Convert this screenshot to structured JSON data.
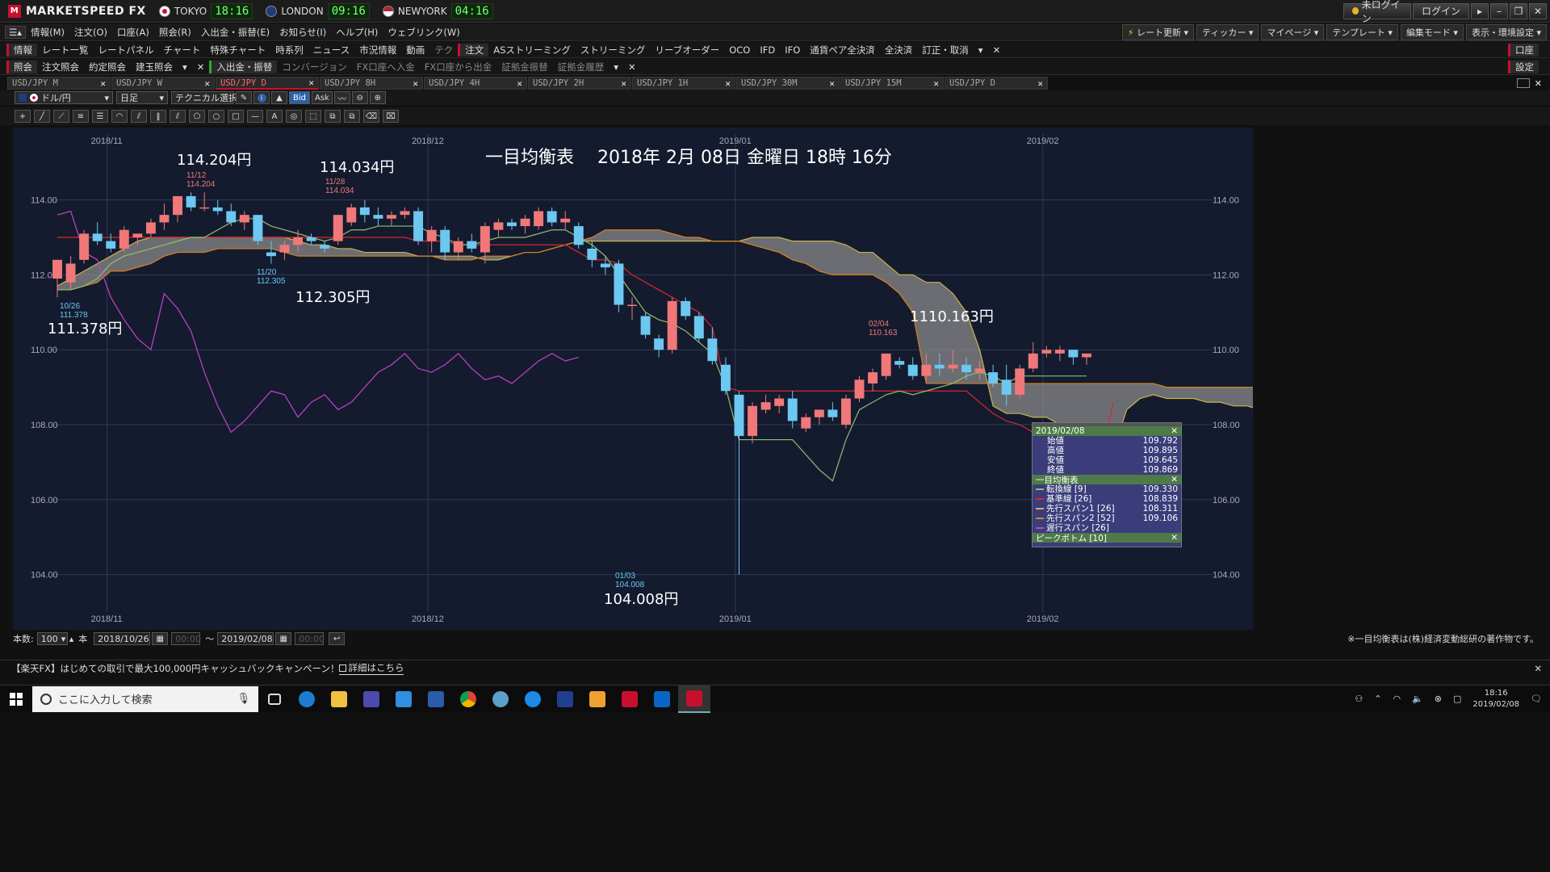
{
  "app": {
    "title": "MARKETSPEED FX",
    "logo_mark": "M",
    "clocks": [
      {
        "city": "TOKYO",
        "time": "18:16"
      },
      {
        "city": "LONDON",
        "time": "09:16"
      },
      {
        "city": "NEWYORK",
        "time": "04:16"
      }
    ],
    "login_status": "未ログイン",
    "login_button": "ログイン"
  },
  "menu": {
    "items": [
      "情報(M)",
      "注文(O)",
      "口座(A)",
      "照会(R)",
      "入出金・振替(E)",
      "お知らせ(I)",
      "ヘルプ(H)",
      "ウェブリンク(W)"
    ],
    "right": [
      "レート更新",
      "ティッカー",
      "マイページ",
      "テンプレート",
      "編集モード",
      "表示・環境設定"
    ]
  },
  "toolbar1": {
    "items": [
      "情報",
      "レート一覧",
      "レートパネル",
      "チャート",
      "特殊チャート",
      "時系列",
      "ニュース",
      "市況情報",
      "動画",
      "テク",
      "注文",
      "ASストリーミング",
      "ストリーミング",
      "リーブオーダー",
      "OCO",
      "IFD",
      "IFO",
      "通貨ペア全決済",
      "全決済",
      "訂正・取消"
    ],
    "right": "口座"
  },
  "toolbar2": {
    "items": [
      "照会",
      "注文照会",
      "約定照会",
      "建玉照会",
      "入出金・振替",
      "コンバージョン",
      "FX口座へ入金",
      "FX口座から出金",
      "証拠金振替",
      "証拠金履歴"
    ],
    "right": "設定"
  },
  "tabs": [
    "USD/JPY M",
    "USD/JPY W",
    "USD/JPY D",
    "USD/JPY 8H",
    "USD/JPY 4H",
    "USD/JPY 2H",
    "USD/JPY 1H",
    "USD/JPY 30M",
    "USD/JPY 15M",
    "USD/JPY D"
  ],
  "active_tab": 2,
  "chart_toolbar": {
    "pair": "ドル/円",
    "period": "日足",
    "technical": "テクニカル選択",
    "bid": "Bid",
    "ask": "Ask"
  },
  "chart_data": {
    "type": "candlestick",
    "title": "一目均衡表　 2018年 2月 08日 金曜日 18時 16分",
    "x_labels": [
      "2018/11",
      "2018/12",
      "2019/01",
      "2019/02"
    ],
    "y_ticks": [
      "114.00",
      "112.00",
      "110.00",
      "108.00",
      "106.00",
      "104.00"
    ],
    "ylim": [
      103.0,
      115.5
    ],
    "annotations": [
      {
        "text": "114.204円",
        "date": "11/12",
        "value": "114.204"
      },
      {
        "text": "114.034円",
        "date": "11/28",
        "value": "114.034"
      },
      {
        "text": "112.305円",
        "date": "11/20",
        "value": "112.305"
      },
      {
        "text": "111.378円",
        "date": "10/26",
        "value": "111.378"
      },
      {
        "text": "104.008円",
        "date": "01/03",
        "value": "104.008"
      },
      {
        "text": "1110.163円",
        "date": "02/04",
        "value": "110.163"
      }
    ],
    "candles": [
      {
        "o": 111.9,
        "h": 112.4,
        "l": 111.4,
        "c": 112.4
      },
      {
        "o": 111.8,
        "h": 112.5,
        "l": 111.6,
        "c": 112.3
      },
      {
        "o": 112.4,
        "h": 113.2,
        "l": 112.3,
        "c": 113.1
      },
      {
        "o": 113.1,
        "h": 113.4,
        "l": 112.8,
        "c": 112.9
      },
      {
        "o": 112.9,
        "h": 113.1,
        "l": 112.6,
        "c": 112.7
      },
      {
        "o": 112.7,
        "h": 113.3,
        "l": 112.6,
        "c": 113.2
      },
      {
        "o": 113.0,
        "h": 113.1,
        "l": 112.8,
        "c": 113.1
      },
      {
        "o": 113.1,
        "h": 113.5,
        "l": 113.0,
        "c": 113.4
      },
      {
        "o": 113.4,
        "h": 113.9,
        "l": 113.2,
        "c": 113.6
      },
      {
        "o": 113.6,
        "h": 114.1,
        "l": 113.4,
        "c": 114.1
      },
      {
        "o": 114.1,
        "h": 114.2,
        "l": 113.7,
        "c": 113.8
      },
      {
        "o": 113.8,
        "h": 114.2,
        "l": 113.7,
        "c": 113.8
      },
      {
        "o": 113.8,
        "h": 114.0,
        "l": 113.6,
        "c": 113.7
      },
      {
        "o": 113.7,
        "h": 113.9,
        "l": 113.3,
        "c": 113.4
      },
      {
        "o": 113.4,
        "h": 113.7,
        "l": 113.2,
        "c": 113.6
      },
      {
        "o": 113.6,
        "h": 113.6,
        "l": 112.8,
        "c": 112.9
      },
      {
        "o": 112.6,
        "h": 112.9,
        "l": 112.3,
        "c": 112.5
      },
      {
        "o": 112.6,
        "h": 112.9,
        "l": 112.4,
        "c": 112.8
      },
      {
        "o": 112.8,
        "h": 113.2,
        "l": 112.6,
        "c": 113.0
      },
      {
        "o": 113.0,
        "h": 113.1,
        "l": 112.8,
        "c": 112.9
      },
      {
        "o": 112.8,
        "h": 112.9,
        "l": 112.6,
        "c": 112.7
      },
      {
        "o": 112.9,
        "h": 113.6,
        "l": 112.8,
        "c": 113.6
      },
      {
        "o": 113.4,
        "h": 113.9,
        "l": 113.3,
        "c": 113.8
      },
      {
        "o": 113.8,
        "h": 114.0,
        "l": 113.4,
        "c": 113.6
      },
      {
        "o": 113.6,
        "h": 113.8,
        "l": 113.3,
        "c": 113.5
      },
      {
        "o": 113.5,
        "h": 113.7,
        "l": 113.3,
        "c": 113.6
      },
      {
        "o": 113.6,
        "h": 113.8,
        "l": 113.5,
        "c": 113.7
      },
      {
        "o": 113.7,
        "h": 113.8,
        "l": 112.8,
        "c": 112.9
      },
      {
        "o": 112.9,
        "h": 113.3,
        "l": 112.6,
        "c": 113.2
      },
      {
        "o": 113.2,
        "h": 113.3,
        "l": 112.4,
        "c": 112.6
      },
      {
        "o": 112.6,
        "h": 113.0,
        "l": 112.4,
        "c": 112.9
      },
      {
        "o": 112.9,
        "h": 113.1,
        "l": 112.6,
        "c": 112.7
      },
      {
        "o": 112.6,
        "h": 113.4,
        "l": 112.3,
        "c": 113.3
      },
      {
        "o": 113.2,
        "h": 113.5,
        "l": 113.0,
        "c": 113.4
      },
      {
        "o": 113.4,
        "h": 113.5,
        "l": 113.2,
        "c": 113.3
      },
      {
        "o": 113.3,
        "h": 113.6,
        "l": 113.1,
        "c": 113.5
      },
      {
        "o": 113.3,
        "h": 113.8,
        "l": 113.2,
        "c": 113.7
      },
      {
        "o": 113.7,
        "h": 113.8,
        "l": 113.3,
        "c": 113.4
      },
      {
        "o": 113.4,
        "h": 113.7,
        "l": 113.2,
        "c": 113.5
      },
      {
        "o": 113.3,
        "h": 113.4,
        "l": 112.7,
        "c": 112.8
      },
      {
        "o": 112.7,
        "h": 112.9,
        "l": 112.2,
        "c": 112.4
      },
      {
        "o": 112.3,
        "h": 112.5,
        "l": 112.0,
        "c": 112.2
      },
      {
        "o": 112.3,
        "h": 112.4,
        "l": 111.0,
        "c": 111.2
      },
      {
        "o": 111.2,
        "h": 111.4,
        "l": 110.8,
        "c": 111.2
      },
      {
        "o": 110.9,
        "h": 111.0,
        "l": 110.3,
        "c": 110.4
      },
      {
        "o": 110.3,
        "h": 110.4,
        "l": 109.8,
        "c": 110.0
      },
      {
        "o": 110.0,
        "h": 111.4,
        "l": 109.9,
        "c": 111.3
      },
      {
        "o": 111.3,
        "h": 111.4,
        "l": 110.8,
        "c": 110.9
      },
      {
        "o": 110.9,
        "h": 111.0,
        "l": 110.2,
        "c": 110.3
      },
      {
        "o": 110.3,
        "h": 110.6,
        "l": 109.6,
        "c": 109.7
      },
      {
        "o": 109.6,
        "h": 109.8,
        "l": 108.8,
        "c": 108.9
      },
      {
        "o": 108.8,
        "h": 108.9,
        "l": 104.0,
        "c": 107.7
      },
      {
        "o": 107.7,
        "h": 108.6,
        "l": 107.5,
        "c": 108.5
      },
      {
        "o": 108.4,
        "h": 108.8,
        "l": 108.3,
        "c": 108.6
      },
      {
        "o": 108.5,
        "h": 108.8,
        "l": 108.3,
        "c": 108.7
      },
      {
        "o": 108.7,
        "h": 108.9,
        "l": 107.9,
        "c": 108.1
      },
      {
        "o": 107.9,
        "h": 108.3,
        "l": 107.8,
        "c": 108.2
      },
      {
        "o": 108.2,
        "h": 108.4,
        "l": 108.0,
        "c": 108.4
      },
      {
        "o": 108.4,
        "h": 108.6,
        "l": 108.1,
        "c": 108.2
      },
      {
        "o": 108.0,
        "h": 108.8,
        "l": 107.9,
        "c": 108.7
      },
      {
        "o": 108.7,
        "h": 109.3,
        "l": 108.6,
        "c": 109.2
      },
      {
        "o": 109.1,
        "h": 109.5,
        "l": 108.9,
        "c": 109.4
      },
      {
        "o": 109.3,
        "h": 109.9,
        "l": 109.2,
        "c": 109.9
      },
      {
        "o": 109.7,
        "h": 109.8,
        "l": 109.5,
        "c": 109.6
      },
      {
        "o": 109.6,
        "h": 109.8,
        "l": 109.2,
        "c": 109.3
      },
      {
        "o": 109.3,
        "h": 109.9,
        "l": 109.2,
        "c": 109.6
      },
      {
        "o": 109.6,
        "h": 109.9,
        "l": 109.3,
        "c": 109.5
      },
      {
        "o": 109.5,
        "h": 110.0,
        "l": 109.4,
        "c": 109.6
      },
      {
        "o": 109.6,
        "h": 109.8,
        "l": 109.2,
        "c": 109.4
      },
      {
        "o": 109.4,
        "h": 109.7,
        "l": 109.2,
        "c": 109.5
      },
      {
        "o": 109.4,
        "h": 109.6,
        "l": 109.0,
        "c": 109.1
      },
      {
        "o": 109.2,
        "h": 109.6,
        "l": 108.5,
        "c": 108.8
      },
      {
        "o": 108.8,
        "h": 109.6,
        "l": 108.7,
        "c": 109.5
      },
      {
        "o": 109.5,
        "h": 110.2,
        "l": 109.4,
        "c": 109.9
      },
      {
        "o": 109.9,
        "h": 110.1,
        "l": 109.8,
        "c": 110.0
      },
      {
        "o": 109.9,
        "h": 110.1,
        "l": 109.7,
        "c": 110.0
      },
      {
        "o": 110.0,
        "h": 110.0,
        "l": 109.6,
        "c": 109.8
      },
      {
        "o": 109.8,
        "h": 109.9,
        "l": 109.6,
        "c": 109.9
      }
    ],
    "tenkan": [
      111.6,
      111.6,
      111.7,
      111.9,
      112.3,
      112.5,
      112.6,
      112.7,
      112.8,
      112.9,
      113.0,
      113.0,
      113.2,
      113.4,
      113.5,
      113.5,
      113.3,
      113.2,
      113.1,
      113.0,
      112.9,
      113.0,
      113.2,
      113.2,
      113.3,
      113.3,
      113.3,
      113.3,
      113.1,
      113.0,
      112.8,
      112.8,
      112.9,
      113.0,
      113.0,
      113.0,
      113.1,
      113.2,
      113.2,
      113.0,
      112.8,
      112.5,
      112.0,
      111.5,
      111.0,
      110.8,
      110.7,
      110.5,
      110.2,
      109.9,
      109.0,
      107.6,
      107.6,
      107.6,
      107.6,
      107.6,
      107.2,
      106.8,
      106.5,
      107.6,
      108.4,
      108.6,
      108.8,
      108.9,
      108.8,
      108.9,
      109.0,
      109.1,
      109.3,
      109.4,
      109.3,
      109.1,
      109.3,
      109.3,
      109.3,
      109.3,
      109.3,
      109.3
    ],
    "kijun": [
      113.0,
      113.0,
      113.0,
      113.0,
      113.0,
      113.0,
      113.0,
      113.0,
      113.0,
      113.0,
      113.0,
      113.0,
      113.0,
      113.0,
      113.0,
      113.0,
      113.0,
      113.0,
      113.0,
      113.0,
      113.0,
      113.0,
      113.0,
      113.0,
      113.0,
      113.0,
      113.0,
      112.9,
      112.9,
      112.9,
      112.8,
      112.8,
      112.8,
      112.8,
      112.8,
      112.8,
      112.8,
      112.8,
      112.8,
      112.6,
      112.4,
      112.4,
      112.3,
      112.0,
      111.8,
      111.6,
      111.4,
      111.2,
      111.0,
      110.6,
      109.0,
      108.9,
      108.9,
      108.9,
      108.9,
      108.9,
      108.9,
      108.9,
      108.9,
      108.9,
      108.9,
      108.9,
      108.9,
      108.9,
      108.9,
      108.9,
      108.9,
      108.9,
      108.9,
      108.6,
      108.3,
      108.1,
      108.0,
      107.8,
      107.7,
      107.5,
      107.3,
      107.0,
      107.0,
      108.6
    ],
    "chikou": [
      113.6,
      113.7,
      112.6,
      112.4,
      111.4,
      110.8,
      110.3,
      110.0,
      111.5,
      111.1,
      110.5,
      109.4,
      108.5,
      107.8,
      108.1,
      108.5,
      108.9,
      108.8,
      108.2,
      108.6,
      108.8,
      108.4,
      108.6,
      109.0,
      109.4,
      109.6,
      109.9,
      109.5,
      109.4,
      109.6,
      109.9,
      109.5,
      109.2,
      109.3,
      109.1,
      109.4,
      109.7,
      109.9,
      109.7,
      109.8
    ],
    "span1": [
      111.7,
      111.9,
      112.1,
      112.3,
      112.5,
      112.7,
      112.9,
      113.0,
      113.0,
      113.0,
      113.0,
      113.0,
      113.0,
      113.0,
      113.0,
      113.0,
      113.0,
      113.0,
      112.9,
      112.8,
      112.8,
      112.7,
      112.7,
      112.6,
      112.6,
      112.6,
      112.6,
      112.5,
      112.5,
      112.5,
      112.5,
      112.5,
      112.4,
      112.4,
      112.5,
      112.6,
      112.6,
      112.7,
      112.8,
      112.9,
      112.9,
      112.9,
      112.9,
      112.9,
      112.9,
      112.9,
      112.9,
      112.9,
      112.9,
      112.9,
      112.9,
      112.9,
      113.0,
      113.0,
      113.0,
      112.9,
      112.9,
      112.9,
      112.9,
      112.8,
      112.6,
      112.6,
      112.3,
      112.0,
      112.0,
      111.8,
      111.8,
      111.5,
      111.0,
      110.0,
      108.5,
      108.3,
      108.3,
      108.2,
      108.2,
      108.0,
      107.9,
      107.8,
      107.6,
      107.3,
      108.4,
      108.7,
      108.8,
      108.7,
      108.7,
      108.7,
      108.6,
      108.6,
      108.5,
      108.5,
      108.4,
      108.3,
      108.3,
      108.2,
      108.2,
      108.3,
      108.8
    ],
    "span2": [
      111.6,
      111.6,
      111.7,
      111.8,
      112.1,
      112.1,
      112.2,
      112.3,
      112.5,
      112.6,
      112.6,
      112.6,
      112.7,
      112.7,
      112.7,
      112.7,
      112.7,
      112.6,
      112.5,
      112.5,
      112.5,
      112.5,
      112.5,
      112.5,
      112.5,
      112.5,
      112.5,
      112.5,
      112.5,
      112.4,
      112.4,
      112.4,
      112.5,
      112.5,
      112.5,
      112.6,
      112.6,
      112.7,
      112.8,
      112.9,
      113.0,
      113.2,
      113.2,
      113.2,
      113.2,
      113.2,
      113.1,
      113.0,
      113.0,
      112.9,
      112.9,
      112.9,
      112.8,
      112.7,
      112.6,
      112.4,
      112.3,
      112.1,
      112.0,
      112.0,
      112.0,
      112.0,
      111.8,
      111.5,
      111.0,
      109.1,
      109.1,
      109.1,
      109.1,
      109.1,
      109.1,
      109.1,
      109.1,
      109.1,
      109.1,
      109.1,
      109.1,
      109.1,
      109.1,
      109.1,
      109.1,
      109.1,
      109.1,
      109.0,
      109.0,
      109.0,
      109.0,
      109.0,
      109.0,
      109.0,
      109.0,
      109.0,
      109.0,
      109.0,
      109.0,
      109.0,
      109.0
    ]
  },
  "info_panel": {
    "date": "2019/02/08",
    "ohlc": [
      {
        "label": "始値",
        "value": "109.792"
      },
      {
        "label": "高値",
        "value": "109.895"
      },
      {
        "label": "安値",
        "value": "109.645"
      },
      {
        "label": "終値",
        "value": "109.869"
      }
    ],
    "section": "一目均衡表",
    "lines": [
      {
        "label": "転換線 [9]",
        "value": "109.330",
        "color": "#8ec06c"
      },
      {
        "label": "基準線 [26]",
        "value": "108.839",
        "color": "#d9262f"
      },
      {
        "label": "先行スパン1 [26]",
        "value": "108.311",
        "color": "#c9b24e"
      },
      {
        "label": "先行スパン2 [52]",
        "value": "109.106",
        "color": "#d9801f"
      },
      {
        "label": "遅行スパン [26]",
        "value": "",
        "color": "#c642c6"
      }
    ],
    "footer": "ピークボトム [10]"
  },
  "status": {
    "count_label": "本数:",
    "count": "100",
    "unit": "本",
    "from": "2018/10/26",
    "time_placeholder": "00:00",
    "tilde": "～",
    "to": "2019/02/08",
    "copyright": "※一目均衡表は(株)経済変動総研の著作物です。"
  },
  "banner": {
    "text": "【楽天FX】はじめての取引で最大100,000円キャッシュバックキャンペーン！",
    "link": "詳細はこちら"
  },
  "taskbar": {
    "search_placeholder": "ここに入力して検索",
    "time": "18:16",
    "date": "2019/02/08"
  },
  "colors": {
    "up": "#f07878",
    "down": "#6cc8f0",
    "chart_bg": "#141b2f",
    "grid": "#2f3a55",
    "cloud": "#8a8a8a"
  }
}
